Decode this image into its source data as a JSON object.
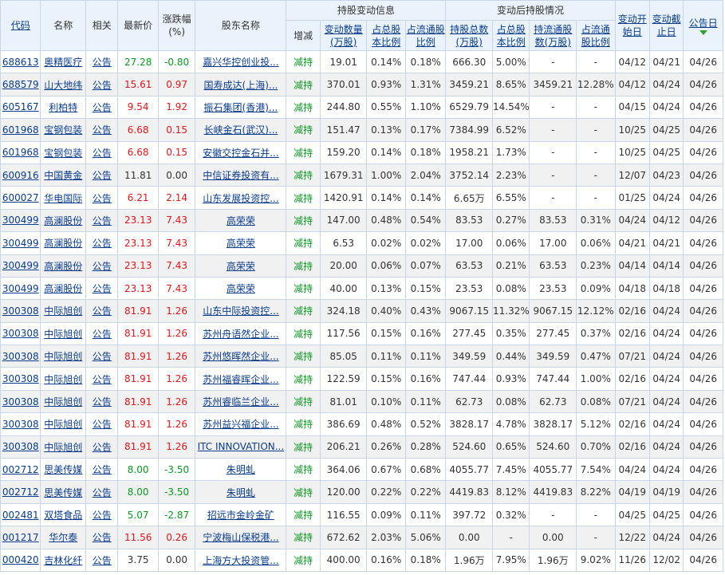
{
  "header": {
    "code": "代码",
    "name": "名称",
    "related": "相关",
    "latest_price": "最新价",
    "change_pct": "涨跌幅(%)",
    "holder_name": "股东名称",
    "change_group": "持股变动信息",
    "after_group": "变动后持股情况",
    "direction": "增减",
    "change_qty": "变动数量(万股)",
    "pct_total": "占总股本比例",
    "pct_float": "占流通股比例",
    "total_hold": "持股总数(万股)",
    "pct_total2": "占总股本比例",
    "float_hold": "持流通股数(万股)",
    "pct_float2": "占流通股比例",
    "start_date": "变动开始日",
    "end_date": "变动截止日",
    "ann_date": "公告日"
  },
  "sort_icon": "green-down-triangle-icon",
  "colors": {
    "up": "#e8141b",
    "down": "#0a9a22",
    "flat": "#333333",
    "link": "#0a3d8f",
    "header_bg": "#eaf2fb",
    "border": "#c9d6e8"
  },
  "rows": [
    {
      "code": "688613",
      "name": "奥精医疗",
      "rel": "公告",
      "price": "27.28",
      "chg": "-0.80",
      "trend": "down",
      "holder": "嘉兴华控创业投...",
      "holder_center": false,
      "dir": "减持",
      "qty": "19.01",
      "p1": "0.14%",
      "p2": "0.18%",
      "total": "666.30",
      "p3": "5.00%",
      "flo": "-",
      "p4": "-",
      "start": "04/12",
      "end": "04/21",
      "ann": "04/26"
    },
    {
      "code": "688579",
      "name": "山大地纬",
      "rel": "公告",
      "price": "15.61",
      "chg": "0.97",
      "trend": "up",
      "holder": "国寿成达(上海)...",
      "holder_center": false,
      "dir": "减持",
      "qty": "370.01",
      "p1": "0.93%",
      "p2": "1.31%",
      "total": "3459.21",
      "p3": "8.65%",
      "flo": "3459.21",
      "p4": "12.28%",
      "start": "04/12",
      "end": "04/24",
      "ann": "04/26"
    },
    {
      "code": "605167",
      "name": "利柏特",
      "rel": "公告",
      "price": "9.54",
      "chg": "1.92",
      "trend": "up",
      "holder": "振石集团(香港)...",
      "holder_center": false,
      "dir": "减持",
      "qty": "244.80",
      "p1": "0.55%",
      "p2": "1.10%",
      "total": "6529.79",
      "p3": "14.54%",
      "flo": "-",
      "p4": "-",
      "start": "04/15",
      "end": "04/24",
      "ann": "04/26"
    },
    {
      "code": "601968",
      "name": "宝钢包装",
      "rel": "公告",
      "price": "6.68",
      "chg": "0.15",
      "trend": "up",
      "holder": "长峡金石(武汉)...",
      "holder_center": false,
      "dir": "减持",
      "qty": "151.47",
      "p1": "0.13%",
      "p2": "0.17%",
      "total": "7384.99",
      "p3": "6.52%",
      "flo": "-",
      "p4": "-",
      "start": "10/25",
      "end": "04/25",
      "ann": "04/26"
    },
    {
      "code": "601968",
      "name": "宝钢包装",
      "rel": "公告",
      "price": "6.68",
      "chg": "0.15",
      "trend": "up",
      "holder": "安徽交控金石并...",
      "holder_center": false,
      "dir": "减持",
      "qty": "159.20",
      "p1": "0.14%",
      "p2": "0.18%",
      "total": "1958.21",
      "p3": "1.73%",
      "flo": "-",
      "p4": "-",
      "start": "10/25",
      "end": "04/25",
      "ann": "04/26"
    },
    {
      "code": "600916",
      "name": "中国黄金",
      "rel": "公告",
      "price": "11.81",
      "chg": "0.00",
      "trend": "flat",
      "holder": "中信证券投资有...",
      "holder_center": false,
      "dir": "减持",
      "qty": "1679.31",
      "p1": "1.00%",
      "p2": "2.04%",
      "total": "3752.14",
      "p3": "2.23%",
      "flo": "-",
      "p4": "-",
      "start": "12/07",
      "end": "04/23",
      "ann": "04/26"
    },
    {
      "code": "600027",
      "name": "华电国际",
      "rel": "公告",
      "price": "6.21",
      "chg": "2.14",
      "trend": "up",
      "holder": "山东发展投资控...",
      "holder_center": false,
      "dir": "减持",
      "qty": "1420.91",
      "p1": "0.14%",
      "p2": "0.14%",
      "total": "6.65万",
      "p3": "6.55%",
      "flo": "-",
      "p4": "-",
      "start": "01/25",
      "end": "04/24",
      "ann": "04/26"
    },
    {
      "code": "300499",
      "name": "高澜股份",
      "rel": "公告",
      "price": "23.13",
      "chg": "7.43",
      "trend": "up",
      "holder": "高荣荣",
      "holder_center": true,
      "dir": "减持",
      "qty": "147.00",
      "p1": "0.48%",
      "p2": "0.54%",
      "total": "83.53",
      "p3": "0.27%",
      "flo": "83.53",
      "p4": "0.31%",
      "start": "04/24",
      "end": "04/12",
      "ann": "04/26"
    },
    {
      "code": "300499",
      "name": "高澜股份",
      "rel": "公告",
      "price": "23.13",
      "chg": "7.43",
      "trend": "up",
      "holder": "高荣荣",
      "holder_center": true,
      "dir": "减持",
      "qty": "6.53",
      "p1": "0.02%",
      "p2": "0.02%",
      "total": "17.00",
      "p3": "0.06%",
      "flo": "17.00",
      "p4": "0.06%",
      "start": "04/21",
      "end": "04/21",
      "ann": "04/26"
    },
    {
      "code": "300499",
      "name": "高澜股份",
      "rel": "公告",
      "price": "23.13",
      "chg": "7.43",
      "trend": "up",
      "holder": "高荣荣",
      "holder_center": true,
      "dir": "减持",
      "qty": "20.00",
      "p1": "0.06%",
      "p2": "0.07%",
      "total": "63.53",
      "p3": "0.21%",
      "flo": "63.53",
      "p4": "0.23%",
      "start": "04/14",
      "end": "04/14",
      "ann": "04/26"
    },
    {
      "code": "300499",
      "name": "高澜股份",
      "rel": "公告",
      "price": "23.13",
      "chg": "7.43",
      "trend": "up",
      "holder": "高荣荣",
      "holder_center": true,
      "dir": "减持",
      "qty": "40.00",
      "p1": "0.13%",
      "p2": "0.15%",
      "total": "23.53",
      "p3": "0.08%",
      "flo": "23.53",
      "p4": "0.09%",
      "start": "04/18",
      "end": "04/18",
      "ann": "04/26"
    },
    {
      "code": "300308",
      "name": "中际旭创",
      "rel": "公告",
      "price": "81.91",
      "chg": "1.26",
      "trend": "up",
      "holder": "山东中际投资控...",
      "holder_center": false,
      "dir": "减持",
      "qty": "324.18",
      "p1": "0.40%",
      "p2": "0.43%",
      "total": "9067.15",
      "p3": "11.32%",
      "flo": "9067.15",
      "p4": "12.12%",
      "start": "02/16",
      "end": "04/24",
      "ann": "04/26"
    },
    {
      "code": "300308",
      "name": "中际旭创",
      "rel": "公告",
      "price": "81.91",
      "chg": "1.26",
      "trend": "up",
      "holder": "苏州舟语然企业...",
      "holder_center": false,
      "dir": "减持",
      "qty": "117.56",
      "p1": "0.15%",
      "p2": "0.16%",
      "total": "277.45",
      "p3": "0.35%",
      "flo": "277.45",
      "p4": "0.37%",
      "start": "02/16",
      "end": "04/24",
      "ann": "04/26"
    },
    {
      "code": "300308",
      "name": "中际旭创",
      "rel": "公告",
      "price": "81.91",
      "chg": "1.26",
      "trend": "up",
      "holder": "苏州悠晖然企业...",
      "holder_center": false,
      "dir": "减持",
      "qty": "85.05",
      "p1": "0.11%",
      "p2": "0.11%",
      "total": "349.59",
      "p3": "0.44%",
      "flo": "349.59",
      "p4": "0.47%",
      "start": "07/21",
      "end": "04/24",
      "ann": "04/26"
    },
    {
      "code": "300308",
      "name": "中际旭创",
      "rel": "公告",
      "price": "81.91",
      "chg": "1.26",
      "trend": "up",
      "holder": "苏州福睿晖企业...",
      "holder_center": false,
      "dir": "减持",
      "qty": "122.59",
      "p1": "0.15%",
      "p2": "0.16%",
      "total": "747.44",
      "p3": "0.93%",
      "flo": "747.44",
      "p4": "1.00%",
      "start": "02/16",
      "end": "04/24",
      "ann": "04/26"
    },
    {
      "code": "300308",
      "name": "中际旭创",
      "rel": "公告",
      "price": "81.91",
      "chg": "1.26",
      "trend": "up",
      "holder": "苏州睿临兰企业...",
      "holder_center": false,
      "dir": "减持",
      "qty": "81.01",
      "p1": "0.10%",
      "p2": "0.11%",
      "total": "62.73",
      "p3": "0.08%",
      "flo": "62.73",
      "p4": "0.08%",
      "start": "07/21",
      "end": "04/24",
      "ann": "04/26"
    },
    {
      "code": "300308",
      "name": "中际旭创",
      "rel": "公告",
      "price": "81.91",
      "chg": "1.26",
      "trend": "up",
      "holder": "苏州益兴福企业...",
      "holder_center": false,
      "dir": "减持",
      "qty": "386.69",
      "p1": "0.48%",
      "p2": "0.52%",
      "total": "3828.17",
      "p3": "4.78%",
      "flo": "3828.17",
      "p4": "5.12%",
      "start": "02/16",
      "end": "04/24",
      "ann": "04/26"
    },
    {
      "code": "300308",
      "name": "中际旭创",
      "rel": "公告",
      "price": "81.91",
      "chg": "1.26",
      "trend": "up",
      "holder": "ITC INNOVATION...",
      "holder_center": false,
      "dir": "减持",
      "qty": "206.21",
      "p1": "0.26%",
      "p2": "0.28%",
      "total": "524.60",
      "p3": "0.65%",
      "flo": "524.60",
      "p4": "0.70%",
      "start": "02/16",
      "end": "04/24",
      "ann": "04/26"
    },
    {
      "code": "002712",
      "name": "思美传媒",
      "rel": "公告",
      "price": "8.00",
      "chg": "-3.50",
      "trend": "down",
      "holder": "朱明虬",
      "holder_center": true,
      "dir": "减持",
      "qty": "364.06",
      "p1": "0.67%",
      "p2": "0.68%",
      "total": "4055.77",
      "p3": "7.45%",
      "flo": "4055.77",
      "p4": "7.54%",
      "start": "04/24",
      "end": "04/24",
      "ann": "04/26"
    },
    {
      "code": "002712",
      "name": "思美传媒",
      "rel": "公告",
      "price": "8.00",
      "chg": "-3.50",
      "trend": "down",
      "holder": "朱明虬",
      "holder_center": true,
      "dir": "减持",
      "qty": "120.00",
      "p1": "0.22%",
      "p2": "0.22%",
      "total": "4419.83",
      "p3": "8.12%",
      "flo": "4419.83",
      "p4": "8.22%",
      "start": "04/19",
      "end": "04/19",
      "ann": "04/26"
    },
    {
      "code": "002481",
      "name": "双塔食品",
      "rel": "公告",
      "price": "5.07",
      "chg": "-2.87",
      "trend": "down",
      "holder": "招远市金岭金矿",
      "holder_center": false,
      "dir": "减持",
      "qty": "116.55",
      "p1": "0.09%",
      "p2": "0.11%",
      "total": "397.72",
      "p3": "0.32%",
      "flo": "-",
      "p4": "-",
      "start": "04/25",
      "end": "04/25",
      "ann": "04/26"
    },
    {
      "code": "001217",
      "name": "华尔泰",
      "rel": "公告",
      "price": "11.56",
      "chg": "0.26",
      "trend": "up",
      "holder": "宁波梅山保税港...",
      "holder_center": false,
      "dir": "减持",
      "qty": "672.62",
      "p1": "2.03%",
      "p2": "5.06%",
      "total": "0.00",
      "p3": "-",
      "flo": "0.00",
      "p4": "-",
      "start": "12/22",
      "end": "04/24",
      "ann": "04/26"
    },
    {
      "code": "000420",
      "name": "吉林化纤",
      "rel": "公告",
      "price": "3.75",
      "chg": "0.00",
      "trend": "flat",
      "holder": "上海方大投资管...",
      "holder_center": false,
      "dir": "减持",
      "qty": "400.00",
      "p1": "0.16%",
      "p2": "0.18%",
      "total": "1.96万",
      "p3": "7.95%",
      "flo": "1.96万",
      "p4": "9.02%",
      "start": "11/26",
      "end": "12/02",
      "ann": "04/26"
    }
  ]
}
